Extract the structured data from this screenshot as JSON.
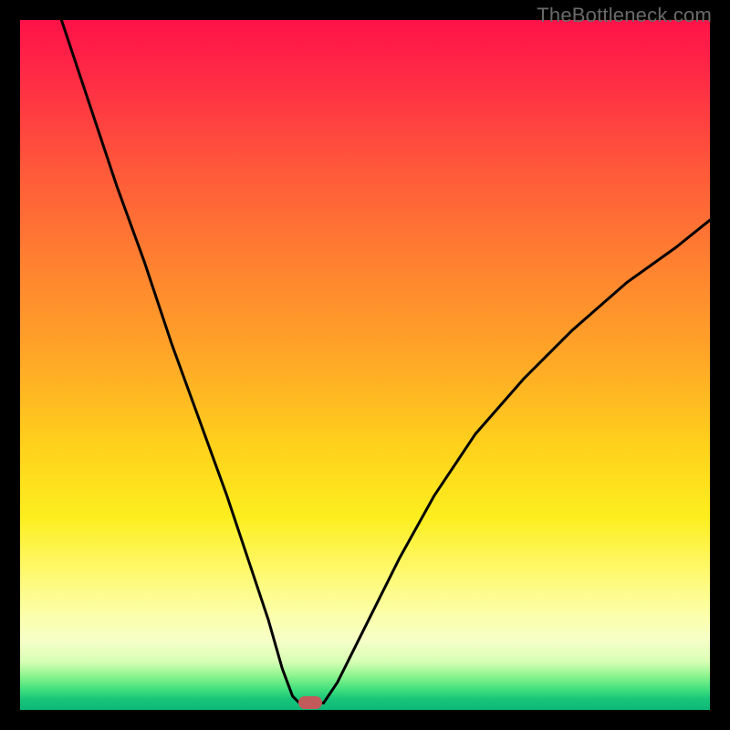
{
  "watermark": "TheBottleneck.com",
  "colors": {
    "frame_bg": "#000000",
    "curve": "#000000",
    "marker": "#c25a5a",
    "gradient_top": "#ff1249",
    "gradient_bottom": "#0db877"
  },
  "chart_data": {
    "type": "line",
    "title": "",
    "xlabel": "",
    "ylabel": "",
    "xlim": [
      0,
      100
    ],
    "ylim": [
      0,
      100
    ],
    "annotations": [
      {
        "kind": "marker",
        "x": 42,
        "y": 1,
        "shape": "rounded-rect",
        "color": "#c25a5a"
      }
    ],
    "series": [
      {
        "name": "left-branch",
        "x": [
          6,
          10,
          14,
          18,
          22,
          26,
          30,
          33,
          36,
          38,
          39.5,
          40.5
        ],
        "y": [
          100,
          88,
          76,
          65,
          53,
          42,
          31,
          22,
          13,
          6,
          2,
          1
        ]
      },
      {
        "name": "flat-bottom",
        "x": [
          40.5,
          44
        ],
        "y": [
          1,
          1
        ]
      },
      {
        "name": "right-branch",
        "x": [
          44,
          46,
          50,
          55,
          60,
          66,
          73,
          80,
          88,
          95,
          100
        ],
        "y": [
          1,
          4,
          12,
          22,
          31,
          40,
          48,
          55,
          62,
          67,
          71
        ]
      }
    ],
    "background_gradient": {
      "direction": "top-to-bottom",
      "stops": [
        {
          "pos": 0.0,
          "color": "#ff1249"
        },
        {
          "pos": 0.36,
          "color": "#ff8330"
        },
        {
          "pos": 0.62,
          "color": "#ffd21c"
        },
        {
          "pos": 0.86,
          "color": "#fcffa8"
        },
        {
          "pos": 1.0,
          "color": "#0db877"
        }
      ]
    }
  }
}
